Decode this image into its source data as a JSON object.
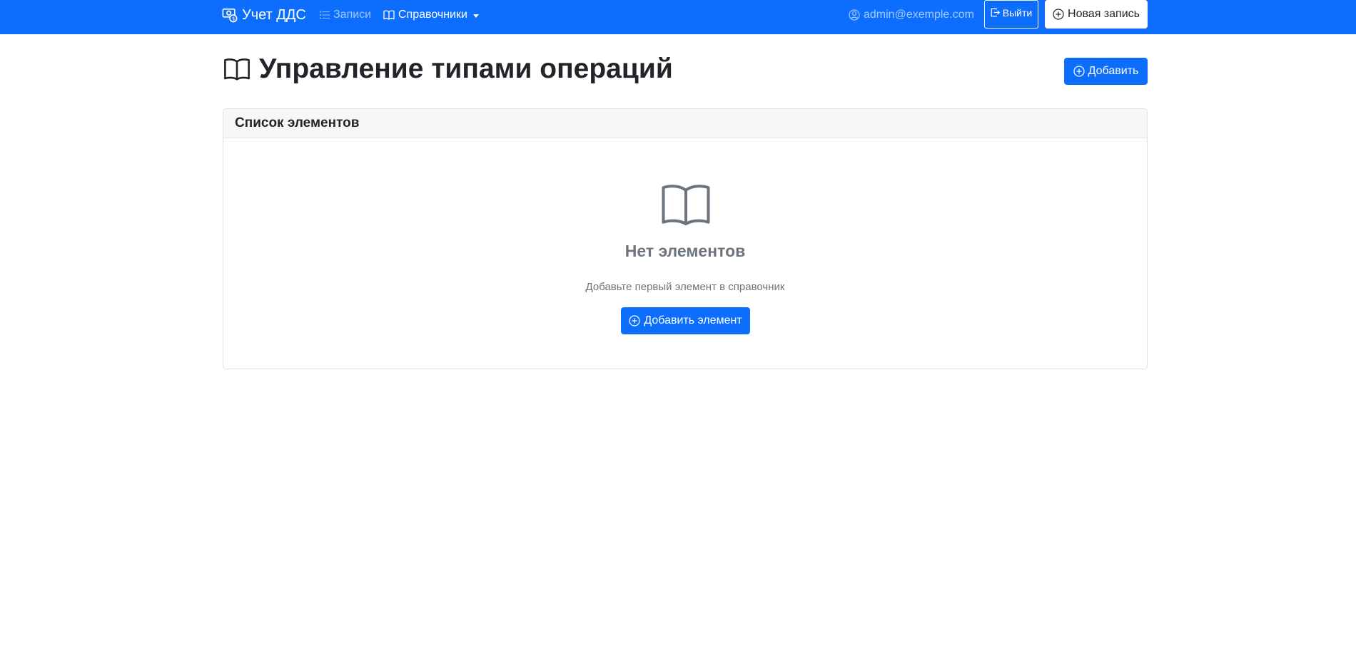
{
  "navbar": {
    "brand": "Учет ДДС",
    "records_label": "Записи",
    "references_label": "Справочники",
    "user_email": "admin@exemple.com",
    "logout_label": "Выйти",
    "new_record_label": "Новая запись"
  },
  "page": {
    "title": "Управление типами операций",
    "add_label": "Добавить"
  },
  "card": {
    "header": "Список элементов",
    "empty_title": "Нет элементов",
    "empty_subtitle": "Добавьте первый элемент в справочник",
    "add_element_label": "Добавить элемент"
  },
  "icons": {
    "brand": "cash-coin-icon",
    "records": "list-icon",
    "references": "book-icon",
    "user": "person-circle-icon",
    "logout": "box-arrow-right-icon",
    "add": "plus-circle-icon",
    "empty": "book-icon"
  },
  "colors": {
    "primary": "#0d6efd",
    "muted": "#6c757d",
    "text": "#212529"
  }
}
